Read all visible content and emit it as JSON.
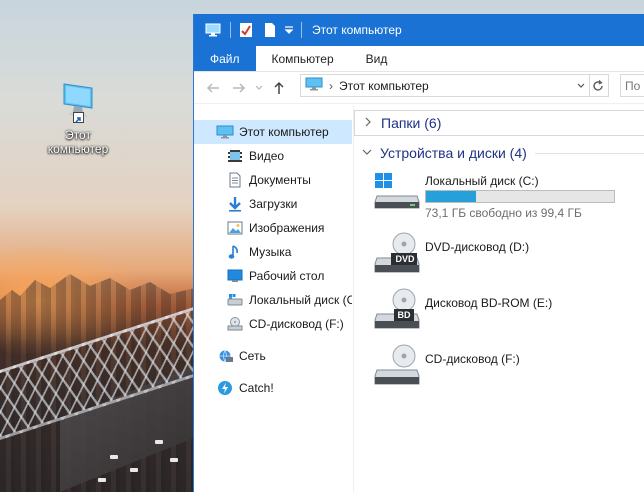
{
  "desktop": {
    "icon_label_line1": "Этот",
    "icon_label_line2": "компьютер"
  },
  "window": {
    "title": "Этот компьютер",
    "accent": "#1a73d4",
    "quick_access": [
      "computer-icon",
      "properties-icon",
      "new-folder-icon",
      "dropdown-arrow-icon"
    ]
  },
  "menubar": {
    "file": "Файл",
    "computer": "Компьютер",
    "view": "Вид"
  },
  "address": {
    "path": "Этот компьютер",
    "search_placeholder": "По"
  },
  "sidebar": {
    "items": [
      {
        "label": "Этот компьютер",
        "icon": "computer-icon",
        "selected": true
      },
      {
        "label": "Видео",
        "icon": "video-icon"
      },
      {
        "label": "Документы",
        "icon": "documents-icon"
      },
      {
        "label": "Загрузки",
        "icon": "downloads-icon"
      },
      {
        "label": "Изображения",
        "icon": "pictures-icon"
      },
      {
        "label": "Музыка",
        "icon": "music-icon"
      },
      {
        "label": "Рабочий стол",
        "icon": "desktop-icon"
      },
      {
        "label": "Локальный диск (C",
        "icon": "local-disk-icon"
      },
      {
        "label": "CD-дисковод (F:)",
        "icon": "cd-drive-icon"
      },
      {
        "label": "Сеть",
        "icon": "network-icon"
      },
      {
        "label": "Catch!",
        "icon": "catch-icon"
      }
    ]
  },
  "content": {
    "folders_header": "Папки (6)",
    "devices_header": "Устройства и диски (4)",
    "drives": [
      {
        "name": "Локальный диск (C:)",
        "info": "73,1 ГБ свободно из 99,4 ГБ",
        "used_fraction": 0.265,
        "icon": "hdd-windows-icon"
      },
      {
        "name": "DVD-дисковод (D:)",
        "badge": "DVD",
        "icon": "dvd-drive-icon"
      },
      {
        "name": "Дисковод BD-ROM (E:)",
        "badge": "BD",
        "icon": "bd-drive-icon"
      },
      {
        "name": "CD-дисковод (F:)",
        "icon": "cd-drive-icon"
      }
    ]
  }
}
